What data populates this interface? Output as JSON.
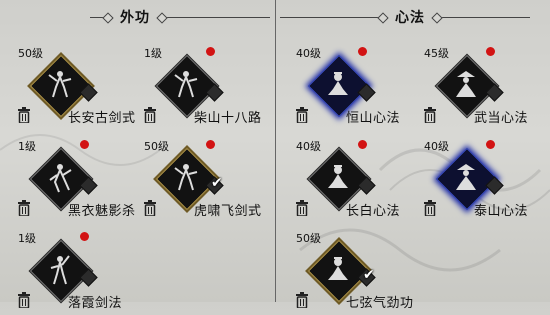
{
  "sections": {
    "external": "外功",
    "internal": "心法"
  },
  "skills": [
    {
      "level": "50级",
      "name": "长安古剑式",
      "red": false,
      "check": false,
      "frame": "gold",
      "icon": "swordsman-icon"
    },
    {
      "level": "1级",
      "name": "柴山十八路",
      "red": true,
      "check": false,
      "frame": "gray",
      "icon": "swordsman-icon"
    },
    {
      "level": "1级",
      "name": "黑衣魅影杀",
      "red": true,
      "check": false,
      "frame": "gray",
      "icon": "assassin-icon"
    },
    {
      "level": "50级",
      "name": "虎啸飞剑式",
      "red": true,
      "check": true,
      "frame": "gold",
      "icon": "swordsman-icon"
    },
    {
      "level": "1级",
      "name": "落霞剑法",
      "red": true,
      "check": false,
      "frame": "gray",
      "icon": "swordswoman-icon"
    },
    {
      "level": "40级",
      "name": "恒山心法",
      "red": true,
      "check": false,
      "frame": "blue",
      "icon": "meditating-monk-icon"
    },
    {
      "level": "45级",
      "name": "武当心法",
      "red": true,
      "check": false,
      "frame": "gray",
      "icon": "taoist-icon"
    },
    {
      "level": "40级",
      "name": "长白心法",
      "red": true,
      "check": false,
      "frame": "gray",
      "icon": "meditating-monk-icon"
    },
    {
      "level": "40级",
      "name": "泰山心法",
      "red": true,
      "check": false,
      "frame": "blue",
      "icon": "taoist-icon"
    },
    {
      "level": "50级",
      "name": "七弦气劲功",
      "red": false,
      "check": true,
      "frame": "gold",
      "icon": "meditating-monk-icon"
    }
  ],
  "colors": {
    "red_dot": "#d21313",
    "gold_frame": "#b69a4a",
    "blue_frame": "#3c4fc7"
  }
}
